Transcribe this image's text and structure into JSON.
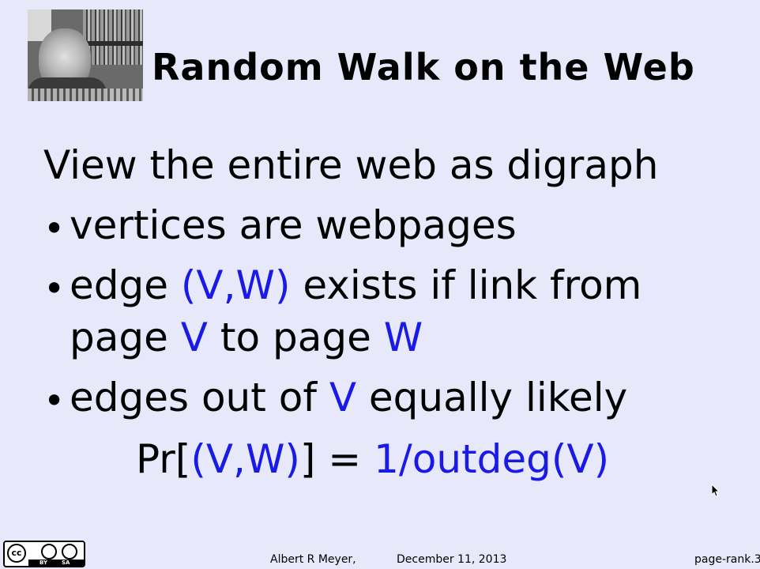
{
  "slide": {
    "title": "Random Walk on the Web",
    "intro": "View the entire web as digraph",
    "bullets": [
      {
        "text": "vertices are webpages"
      },
      {
        "pre": "edge ",
        "edge": "(V,W)",
        "mid": " exists if link from",
        "line2_pre": "page ",
        "v": "V",
        "to": " to page ",
        "w": "W"
      },
      {
        "pre": "edges out of ",
        "v": "V",
        "post": " equally likely"
      }
    ],
    "formula": {
      "pr_open": "Pr[",
      "vw": "(V,W)",
      "pr_close": "] = ",
      "rhs": "1/outdeg(V)"
    }
  },
  "footer": {
    "author": "Albert R Meyer,",
    "date": "December 11, 2013",
    "slide_id": "page-rank.3"
  },
  "license": {
    "by": "BY",
    "sa": "SA",
    "cc": "cc"
  },
  "colors": {
    "background": "#e8e8fb",
    "highlight": "#1a1ae6"
  }
}
